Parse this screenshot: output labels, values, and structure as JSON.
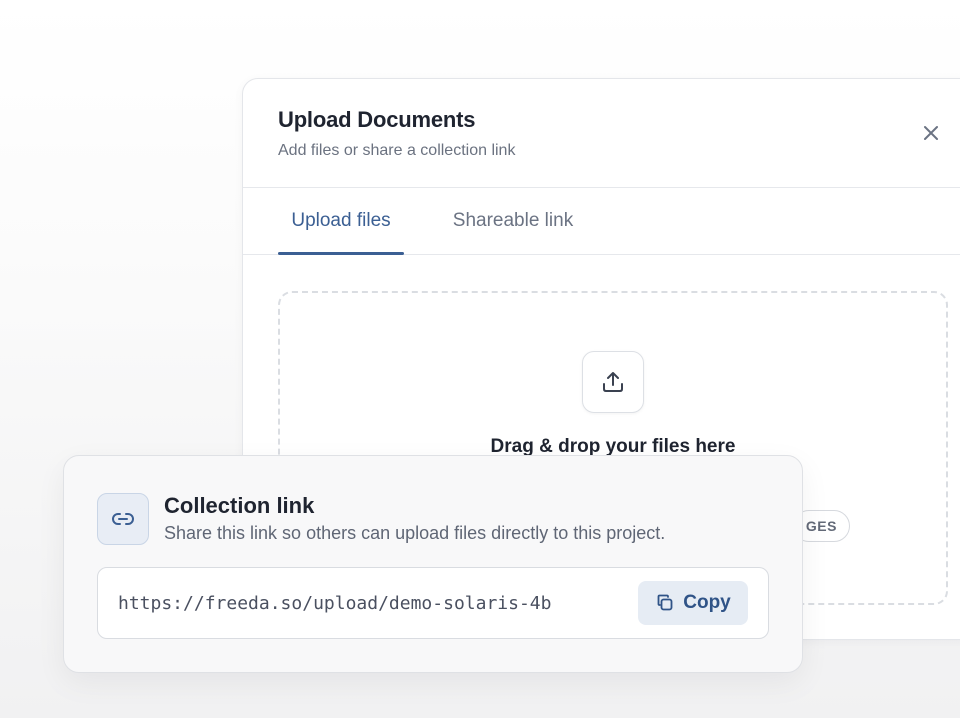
{
  "modal": {
    "title": "Upload Documents",
    "subtitle": "Add files or share a collection link",
    "close_icon": "close-icon"
  },
  "tabs": [
    {
      "label": "Upload files",
      "active": true
    },
    {
      "label": "Shareable link",
      "active": false
    }
  ],
  "dropzone": {
    "icon": "upload-icon",
    "title": "Drag & drop your files here",
    "visible_chip": "GES"
  },
  "link_card": {
    "icon": "link-icon",
    "title": "Collection link",
    "description": "Share this link so others can upload files directly to this project.",
    "url": "https://freeda.so/upload/demo-solaris-4b",
    "copy_label": "Copy",
    "copy_icon": "copy-icon"
  },
  "colors": {
    "accent": "#3b5f93",
    "copy_bg": "#e6ecf4",
    "text_primary": "#1f2430",
    "text_muted": "#6b7280"
  }
}
